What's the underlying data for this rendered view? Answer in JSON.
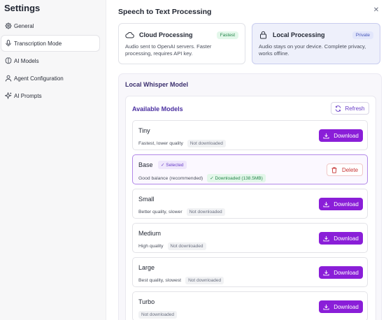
{
  "app": {
    "title": "Settings"
  },
  "sidebar": {
    "items": [
      {
        "label": "General",
        "icon": "gear-icon"
      },
      {
        "label": "Transcription Mode",
        "icon": "microphone-icon",
        "active": true
      },
      {
        "label": "AI Models",
        "icon": "brain-icon"
      },
      {
        "label": "Agent Configuration",
        "icon": "user-icon"
      },
      {
        "label": "AI Prompts",
        "icon": "sparkle-icon"
      }
    ]
  },
  "main": {
    "title": "Speech to Text Processing",
    "close_icon": "close-icon",
    "options": [
      {
        "title": "Cloud Processing",
        "badge": "Fastest",
        "description": "Audio sent to OpenAI servers. Faster processing, requires API key.",
        "icon": "cloud-icon"
      },
      {
        "title": "Local Processing",
        "badge": "Private",
        "description": "Audio stays on your device. Complete privacy, works offline.",
        "icon": "lock-icon",
        "selected": true
      }
    ],
    "whisper": {
      "title": "Local Whisper Model",
      "available_title": "Available Models",
      "refresh_label": "Refresh",
      "models": [
        {
          "name": "Tiny",
          "description": "Fastest, lower quality",
          "status": "Not downloaded",
          "action": "Download"
        },
        {
          "name": "Base",
          "selected_badge": "✓ Selected",
          "description": "Good balance (recommended)",
          "status": "✓ Downloaded (138.5MB)",
          "action": "Delete",
          "selected": true
        },
        {
          "name": "Small",
          "description": "Better quality, slower",
          "status": "Not downloaded",
          "action": "Download"
        },
        {
          "name": "Medium",
          "description": "High quality",
          "status": "Not downloaded",
          "action": "Download"
        },
        {
          "name": "Large",
          "description": "Best quality, slowest",
          "status": "Not downloaded",
          "action": "Download"
        },
        {
          "name": "Turbo",
          "description": "",
          "status": "Not downloaded",
          "action": "Download"
        }
      ]
    }
  },
  "colors": {
    "accent": "#8a1ed8",
    "selected_border": "#b289e8",
    "success": "#24864a",
    "danger": "#c73434"
  }
}
